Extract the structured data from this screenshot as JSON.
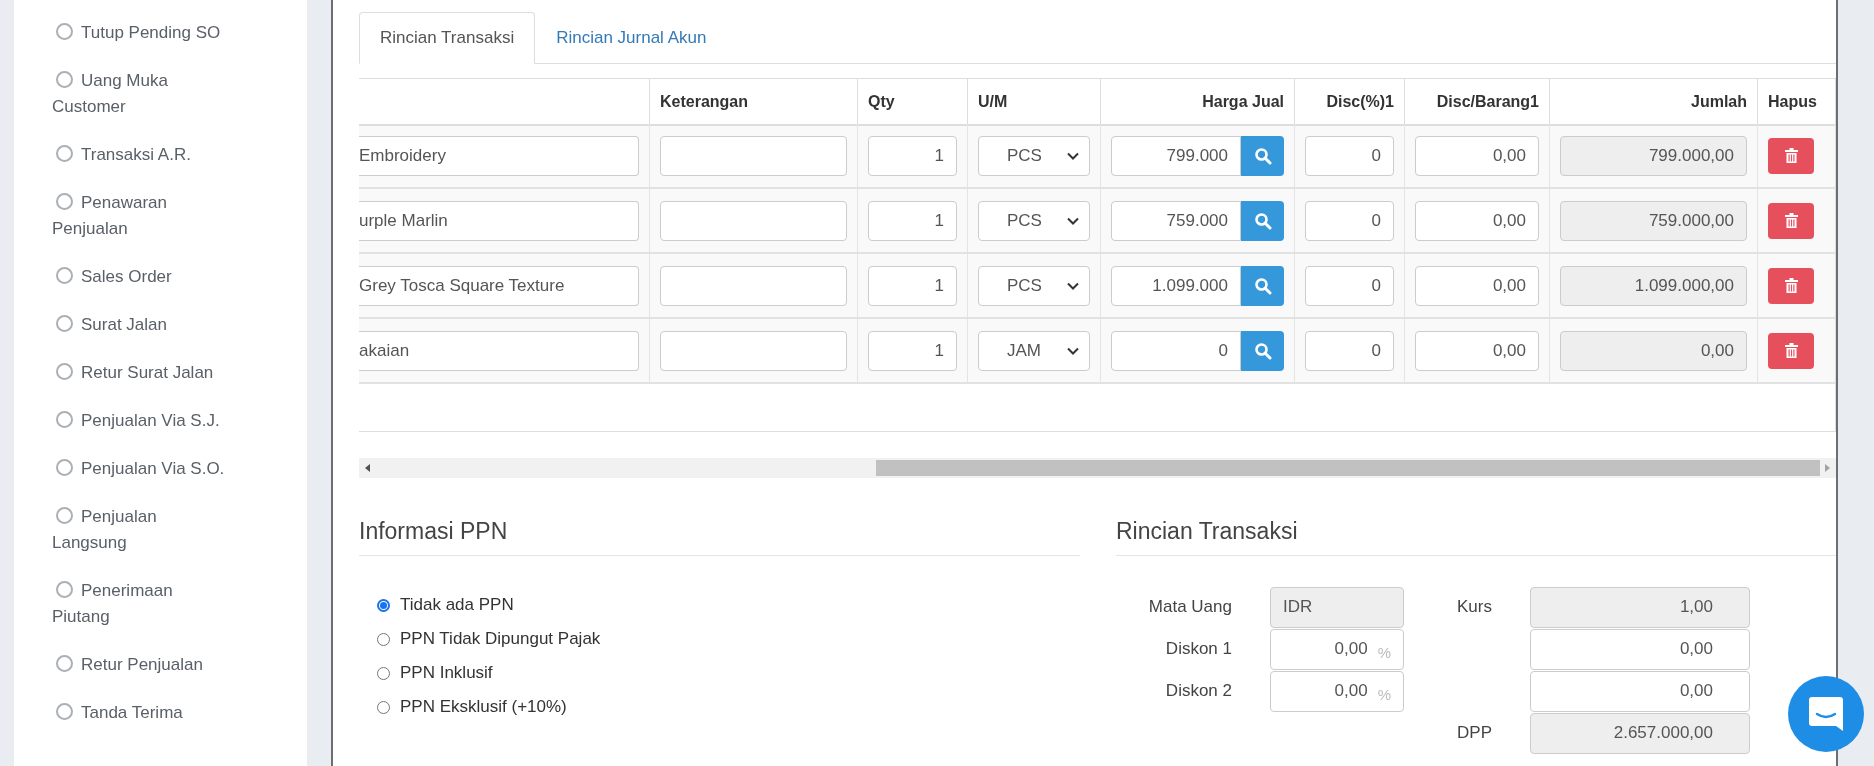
{
  "sidebar": {
    "items": [
      {
        "label": "Tutup Pending SO"
      },
      {
        "label": "Uang Muka Customer"
      },
      {
        "label": "Transaksi A.R."
      },
      {
        "label": "Penawaran Penjualan"
      },
      {
        "label": "Sales Order"
      },
      {
        "label": "Surat Jalan"
      },
      {
        "label": "Retur Surat Jalan"
      },
      {
        "label": "Penjualan Via S.J."
      },
      {
        "label": "Penjualan Via S.O."
      },
      {
        "label": "Penjualan Langsung"
      },
      {
        "label": "Penerimaan Piutang"
      },
      {
        "label": "Retur Penjualan"
      },
      {
        "label": "Tanda Terima"
      }
    ]
  },
  "tabs": [
    {
      "label": "Rincian Transaksi",
      "selected": true
    },
    {
      "label": "Rincian Jurnal Akun",
      "selected": false
    }
  ],
  "table": {
    "columns": [
      "Keterangan",
      "Qty",
      "U/M",
      "Harga Jual",
      "Disc(%)1",
      "Disc/Barang1",
      "Jumlah",
      "Hapus"
    ],
    "rows": [
      {
        "item": "Embroidery",
        "qty": "1",
        "unit": "PCS",
        "price": "799.000",
        "disc_pct": "0",
        "disc_item": "0,00",
        "total": "799.000,00"
      },
      {
        "item": "urple Marlin",
        "qty": "1",
        "unit": "PCS",
        "price": "759.000",
        "disc_pct": "0",
        "disc_item": "0,00",
        "total": "759.000,00"
      },
      {
        "item": "Grey Tosca Square Texture",
        "qty": "1",
        "unit": "PCS",
        "price": "1.099.000",
        "disc_pct": "0",
        "disc_item": "0,00",
        "total": "1.099.000,00"
      },
      {
        "item": "akaian",
        "qty": "1",
        "unit": "JAM",
        "price": "0",
        "disc_pct": "0",
        "disc_item": "0,00",
        "total": "0,00"
      }
    ]
  },
  "ppn": {
    "title": "Informasi PPN",
    "options": [
      {
        "label": "Tidak ada PPN",
        "selected": true
      },
      {
        "label": "PPN Tidak Dipungut Pajak",
        "selected": false
      },
      {
        "label": "PPN Inklusif",
        "selected": false
      },
      {
        "label": "PPN Eksklusif (+10%)",
        "selected": false
      }
    ]
  },
  "summary": {
    "title": "Rincian Transaksi",
    "left": [
      {
        "label": "Mata Uang",
        "value": "IDR",
        "kind": "text",
        "readonly": true
      },
      {
        "label": "Diskon 1",
        "value": "0,00",
        "unit": "%",
        "kind": "number",
        "readonly": false
      },
      {
        "label": "Diskon 2",
        "value": "0,00",
        "unit": "%",
        "kind": "number",
        "readonly": false
      }
    ],
    "right": [
      {
        "label": "Kurs",
        "value": "1,00",
        "kind": "number",
        "readonly": true
      },
      {
        "value": "0,00",
        "kind": "number",
        "readonly": false
      },
      {
        "value": "0,00",
        "kind": "number",
        "readonly": false
      },
      {
        "label": "DPP",
        "value": "2.657.000,00",
        "kind": "number",
        "readonly": true
      }
    ]
  }
}
